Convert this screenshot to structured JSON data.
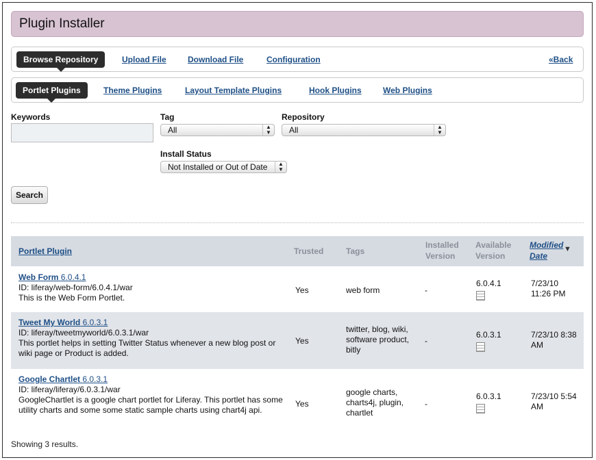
{
  "title": "Plugin Installer",
  "top_tabs": {
    "active": "Browse Repository",
    "links": [
      "Upload File",
      "Download File",
      "Configuration"
    ],
    "back": "«Back"
  },
  "plugin_tabs": {
    "active": "Portlet Plugins",
    "links": [
      "Theme Plugins",
      "Layout Template Plugins",
      "Hook Plugins",
      "Web Plugins"
    ]
  },
  "filters": {
    "keywords_label": "Keywords",
    "keywords_value": "",
    "tag_label": "Tag",
    "tag_value": "All",
    "repository_label": "Repository",
    "repository_value": "All",
    "install_status_label": "Install Status",
    "install_status_value": "Not Installed or Out of Date",
    "search_button": "Search"
  },
  "table": {
    "headers": {
      "plugin": "Portlet Plugin",
      "trusted": "Trusted",
      "tags": "Tags",
      "installed_1": "Installed",
      "installed_2": "Version",
      "available_1": "Available",
      "available_2": "Version",
      "modified_1": "Modified",
      "modified_2": "Date"
    },
    "rows": [
      {
        "name": "Web Form",
        "version": "6.0.4.1",
        "id": "ID: liferay/web-form/6.0.4.1/war",
        "desc": "This is the Web Form Portlet.",
        "trusted": "Yes",
        "tags": "web form",
        "installed": "-",
        "available": "6.0.4.1",
        "modified": "7/23/10 11:26 PM"
      },
      {
        "name": "Tweet My World",
        "version": "6.0.3.1",
        "id": "ID: liferay/tweetmyworld/6.0.3.1/war",
        "desc": "This portlet helps in setting Twitter Status whenever a new blog post or wiki page or Product is added.",
        "trusted": "Yes",
        "tags": "twitter, blog, wiki, software product, bitly",
        "installed": "-",
        "available": "6.0.3.1",
        "modified": "7/23/10 8:38 AM"
      },
      {
        "name": "Google Chartlet",
        "version": "6.0.3.1",
        "id": "ID: liferay/liferay/6.0.3.1/war",
        "desc": "GoogleChartlet is a google chart portlet for Liferay. This portlet has some utility charts and some some static sample charts using chart4j api.",
        "trusted": "Yes",
        "tags": "google charts, charts4j, plugin, chartlet",
        "installed": "-",
        "available": "6.0.3.1",
        "modified": "7/23/10 5:54 AM"
      }
    ]
  },
  "footer": "Showing 3 results.",
  "colors": {
    "title_bg": "#d8c3d3",
    "link": "#1e4f86",
    "header_bg": "#d6dbe2",
    "row_alt": "#e1e4e9",
    "active_tab": "#2d2d2d"
  }
}
